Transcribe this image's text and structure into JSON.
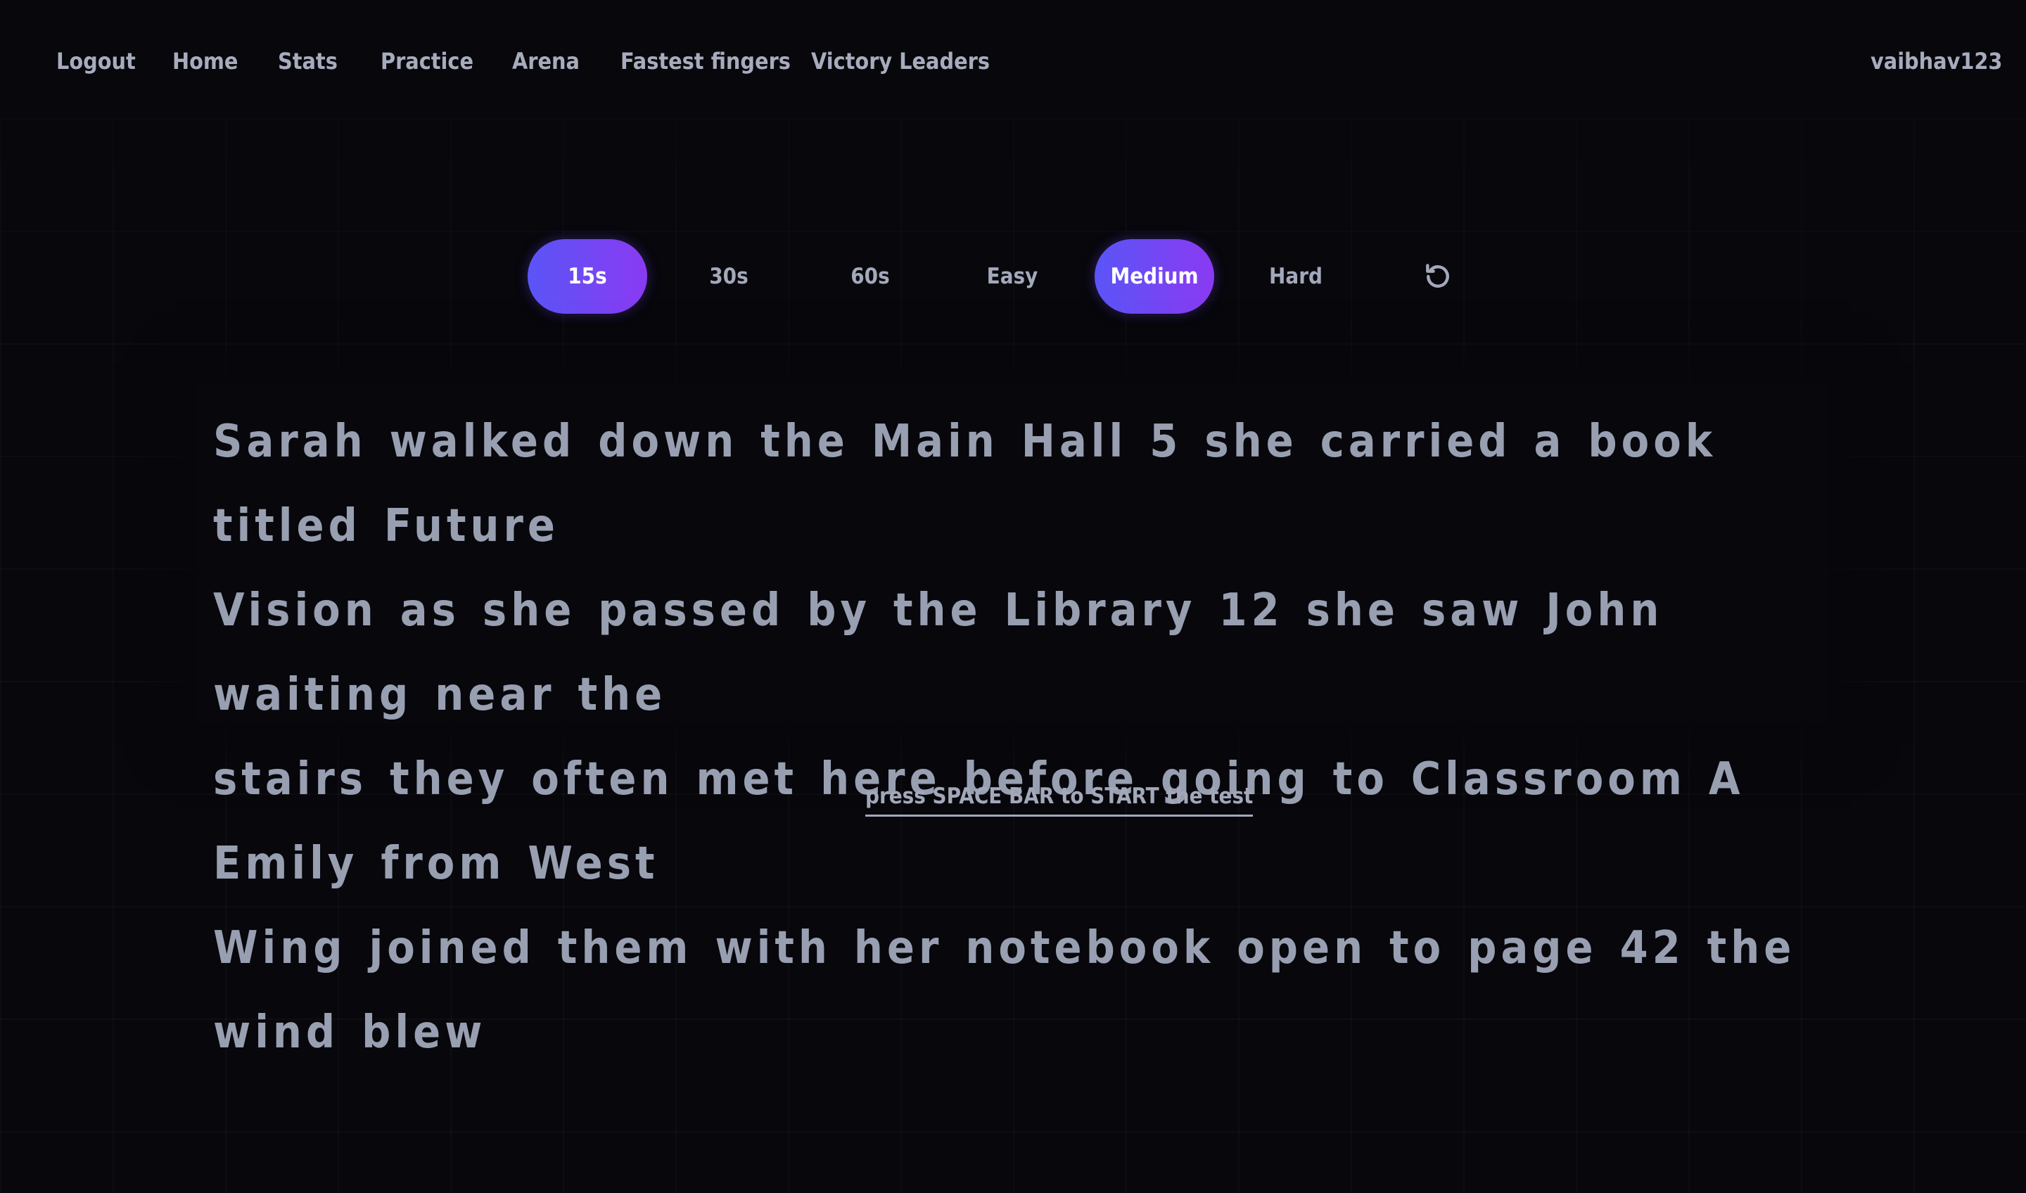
{
  "nav": {
    "items": [
      {
        "label": "Logout"
      },
      {
        "label": "Home"
      },
      {
        "label": "Stats"
      },
      {
        "label": "Practice"
      },
      {
        "label": "Arena"
      },
      {
        "label": "Fastest fingers"
      },
      {
        "label": "Victory Leaders"
      }
    ],
    "username": "vaibhav123"
  },
  "toolbar": {
    "durations": [
      {
        "label": "15s",
        "selected": true
      },
      {
        "label": "30s",
        "selected": false
      },
      {
        "label": "60s",
        "selected": false
      }
    ],
    "difficulties": [
      {
        "label": "Easy",
        "selected": false
      },
      {
        "label": "Medium",
        "selected": true
      },
      {
        "label": "Hard",
        "selected": false
      }
    ],
    "restart_icon": "restart-icon"
  },
  "passage": {
    "lines": [
      "Sarah walked down the Main Hall 5 she carried a book titled Future",
      "Vision as she passed by the Library 12 she saw John waiting near the",
      "stairs they often met here before going to Classroom A Emily from West",
      "Wing joined them with her notebook open to page 42 the wind blew"
    ]
  },
  "hint": "press SPACE BAR to START the test",
  "colors": {
    "background": "#07070c",
    "text": "#989fb1",
    "accent_start": "#5a55f6",
    "accent_end": "#8a3af2"
  }
}
